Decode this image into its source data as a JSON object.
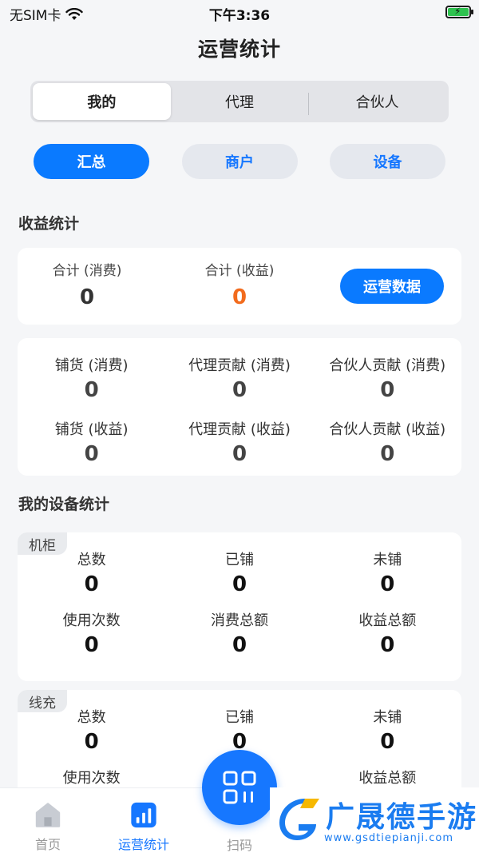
{
  "status_bar": {
    "carrier": "无SIM卡",
    "time": "下午3:36"
  },
  "title": "运营统计",
  "segments": [
    "我的",
    "代理",
    "合伙人"
  ],
  "pills": [
    "汇总",
    "商户",
    "设备"
  ],
  "revenue": {
    "section_title": "收益统计",
    "total_consume_label": "合计 (消费)",
    "total_consume_value": "0",
    "total_income_label": "合计 (收益)",
    "total_income_value": "0",
    "ops_button": "运营数据"
  },
  "breakdown": [
    {
      "label": "铺货 (消费)",
      "value": "0"
    },
    {
      "label": "代理贡献 (消费)",
      "value": "0"
    },
    {
      "label": "合伙人贡献 (消费)",
      "value": "0"
    },
    {
      "label": "铺货 (收益)",
      "value": "0"
    },
    {
      "label": "代理贡献 (收益)",
      "value": "0"
    },
    {
      "label": "合伙人贡献 (收益)",
      "value": "0"
    }
  ],
  "devices": {
    "section_title": "我的设备统计",
    "cabinet": {
      "tag": "机柜",
      "items": [
        {
          "label": "总数",
          "value": "0"
        },
        {
          "label": "已铺",
          "value": "0"
        },
        {
          "label": "未铺",
          "value": "0"
        },
        {
          "label": "使用次数",
          "value": "0"
        },
        {
          "label": "消费总额",
          "value": "0"
        },
        {
          "label": "收益总额",
          "value": "0"
        }
      ]
    },
    "cable": {
      "tag": "线充",
      "items": [
        {
          "label": "总数",
          "value": "0"
        },
        {
          "label": "已铺",
          "value": "0"
        },
        {
          "label": "未铺",
          "value": "0"
        },
        {
          "label": "使用次数",
          "value": ""
        },
        {
          "label": "",
          "value": ""
        },
        {
          "label": "收益总额",
          "value": ""
        }
      ]
    }
  },
  "tabbar": {
    "home": "首页",
    "stats": "运营统计",
    "scan": "扫码"
  },
  "watermark": {
    "text": "广晟德手游",
    "url": "www.gsdtiepianji.com"
  },
  "colors": {
    "accent": "#1677ff",
    "orange": "#f26b1d"
  }
}
